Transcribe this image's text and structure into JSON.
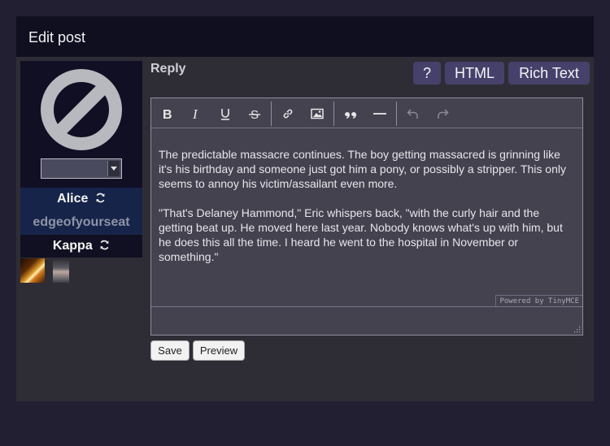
{
  "header": {
    "title": "Edit post"
  },
  "profile": {
    "avatar_select_value": "",
    "characters": [
      {
        "name": "Alice"
      },
      {
        "name": "edgeofyourseat"
      },
      {
        "name": "Kappa"
      }
    ]
  },
  "reply": {
    "label": "Reply"
  },
  "tabs": {
    "help": "?",
    "html": "HTML",
    "rich_text": "Rich Text"
  },
  "toolbar": {
    "icons": [
      "bold-icon",
      "italic-icon",
      "underline-icon",
      "strikethrough-icon",
      "link-icon",
      "image-icon",
      "blockquote-icon",
      "horizontal-rule-icon",
      "undo-icon",
      "redo-icon"
    ]
  },
  "editor": {
    "paragraphs": [
      "The predictable massacre continues. The boy getting massacred is grinning like it's his birthday and someone just got him a pony, or possibly a stripper. This only seems to annoy his victim/assailant even more.",
      "\"That's Delaney Hammond,\" Eric whispers back, \"with the curly hair and the getting beat up. He moved here last year. Nobody knows what's up with him, but he does this all the time. I heard he went to the hospital in November or something.\""
    ],
    "powered_by": "Powered by TinyMCE"
  },
  "actions": {
    "save": "Save",
    "preview": "Preview"
  },
  "colors": {
    "page_bg": "#221f33",
    "header_bg": "#100f1f",
    "tab_bg": "#46416b",
    "editor_bg": "#44424f"
  }
}
